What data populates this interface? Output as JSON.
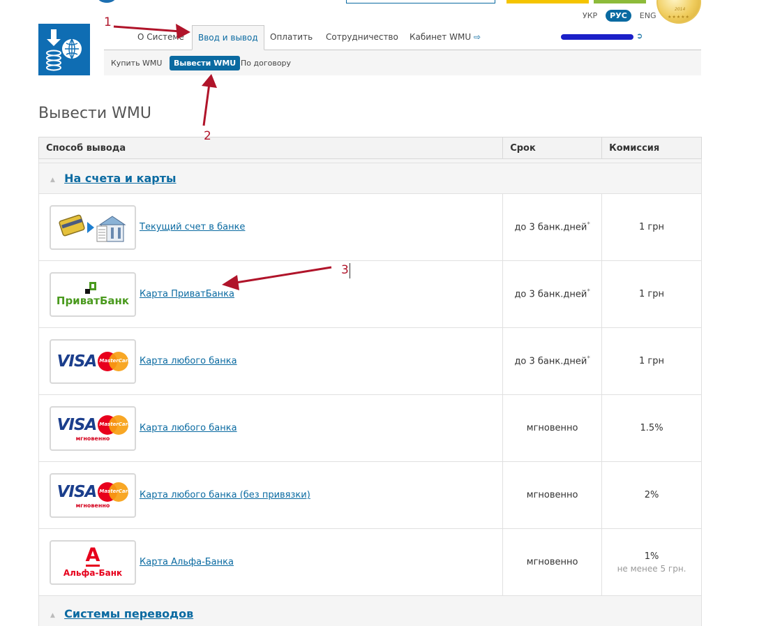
{
  "header": {
    "languages": [
      {
        "label": "УКР",
        "active": false
      },
      {
        "label": "РУС",
        "active": true
      },
      {
        "label": "ENG",
        "active": false
      }
    ],
    "medal_year": "2014",
    "medal_stars": "★★★★★"
  },
  "nav": {
    "items": [
      {
        "label": "О Системе",
        "active": false
      },
      {
        "label": "Ввод и вывод",
        "active": true
      },
      {
        "label": "Оплатить",
        "active": false
      },
      {
        "label": "Сотрудничество",
        "active": false
      },
      {
        "label": "Кабинет WMU",
        "active": false
      }
    ],
    "cabinet_icon": "login-arrow-icon",
    "logout_icon": "logout-icon"
  },
  "subnav": {
    "items": [
      {
        "label": "Купить WMU",
        "active": false
      },
      {
        "label": "Вывести WMU",
        "active": true
      },
      {
        "label": "По договору",
        "active": false
      }
    ]
  },
  "page": {
    "title": "Вывести WMU"
  },
  "table": {
    "headers": [
      "Способ вывода",
      "Срок",
      "Комиссия"
    ],
    "groups": [
      {
        "title": "На счета и карты",
        "methods": [
          {
            "name": "Текущий счет в банке",
            "term": "до 3 банк.дней",
            "term_note": "*",
            "fee": "1 грн",
            "logo": "bank-transfer-icon"
          },
          {
            "name": "Карта ПриватБанка",
            "term": "до 3 банк.дней",
            "term_note": "*",
            "fee": "1 грн",
            "logo": "privatbank-logo",
            "logo_text": "ПриватБанк"
          },
          {
            "name": "Карта любого банка",
            "term": "до 3 банк.дней",
            "term_note": "*",
            "fee": "1 грн",
            "logo": "visa-mastercard-logo",
            "logo_visa": "VISA",
            "logo_mc": "MasterCard"
          },
          {
            "name": "Карта любого банка",
            "term": "мгновенно",
            "fee": "1.5%",
            "logo": "visa-mastercard-instant-logo",
            "logo_visa": "VISA",
            "logo_mc": "MasterCard",
            "logo_sub": "мгновенно"
          },
          {
            "name": "Карта любого банка (без привязки)",
            "term": "мгновенно",
            "fee": "2%",
            "logo": "visa-mastercard-instant-logo",
            "logo_visa": "VISA",
            "logo_mc": "MasterCard",
            "logo_sub": "мгновенно"
          },
          {
            "name": "Карта Альфа-Банка",
            "term": "мгновенно",
            "fee": "1%",
            "fee_sub": "не менее 5 грн.",
            "logo": "alfabank-logo",
            "logo_letter": "А",
            "logo_text": "Альфа-Банк"
          }
        ]
      },
      {
        "title": "Системы переводов",
        "methods": []
      }
    ]
  },
  "annotations": {
    "step1": "1",
    "step2": "2",
    "step3": "3",
    "color": "#b0142a"
  },
  "colors": {
    "accent": "#0a6aa1",
    "logo_bg": "#0f6db3",
    "privat_green": "#4a9a1e",
    "alfa_red": "#e6001c"
  }
}
